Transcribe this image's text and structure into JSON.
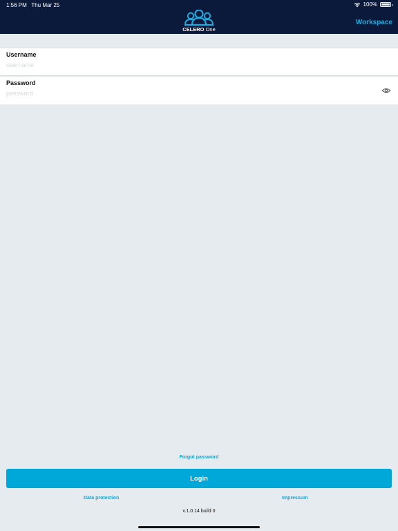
{
  "status_bar": {
    "time": "1:56 PM",
    "date": "Thu Mar 25",
    "battery": "100%",
    "battery_level": 1.0
  },
  "header": {
    "logo_brand": "CELERO",
    "logo_product": "One",
    "workspace_label": "Workspace"
  },
  "form": {
    "username_label": "Username",
    "username_placeholder": "username",
    "username_value": "",
    "password_label": "Password",
    "password_placeholder": "password",
    "password_value": ""
  },
  "footer": {
    "forgot_password": "Forgot password",
    "login_label": "Login",
    "data_protection": "Data protection",
    "impressum": "Impressum",
    "version": "v.1.0.14 build 0"
  },
  "colors": {
    "header_bg": "#0b1a3b",
    "accent": "#00a7d9",
    "page_bg": "#e6ebef"
  },
  "icons": {
    "wifi": "wifi-icon",
    "battery": "battery-icon",
    "logo": "people-group-icon",
    "password_toggle": "eye-icon"
  }
}
